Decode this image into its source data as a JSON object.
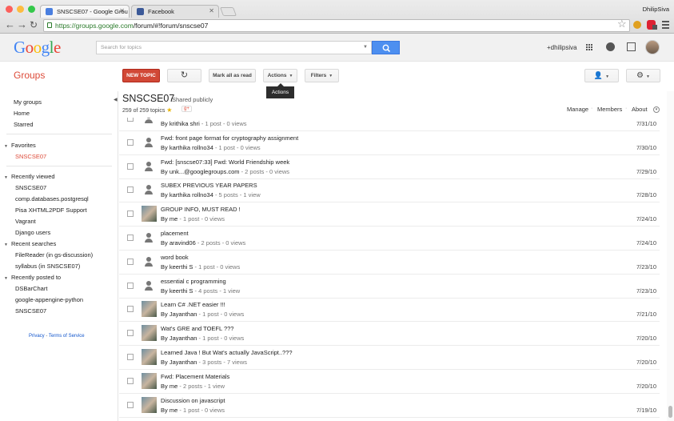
{
  "browser": {
    "tabs": [
      {
        "label": "SNSCSE07 - Google Grou",
        "active": true
      },
      {
        "label": "Facebook",
        "active": false
      }
    ],
    "user": "DhilipSiva",
    "url_host": "https://groups.google.com",
    "url_path": "/forum/#!forum/snscse07"
  },
  "gbar": {
    "logo": "Google",
    "search_placeholder": "Search for topics",
    "plus_user": "+dhilipsiva"
  },
  "toolbar": {
    "app_title": "Groups",
    "new_topic": "NEW TOPIC",
    "mark_read": "Mark all as read",
    "actions": "Actions",
    "filters": "Filters",
    "tooltip": "Actions"
  },
  "sidebar": {
    "top": [
      "My groups",
      "Home",
      "Starred"
    ],
    "favorites_title": "Favorites",
    "favorites": [
      "SNSCSE07"
    ],
    "recently_viewed_title": "Recently viewed",
    "recently_viewed": [
      "SNSCSE07",
      "comp.databases.postgresql",
      "Pisa XHTML2PDF Support",
      "Vagrant",
      "Django users"
    ],
    "recent_searches_title": "Recent searches",
    "recent_searches": [
      "FileReader (in gs-discussion)",
      "syllabus (in SNSCSE07)"
    ],
    "recently_posted_title": "Recently posted to",
    "recently_posted": [
      "DSBarChart",
      "google-appengine-python",
      "SNSCSE07"
    ],
    "privacy": "Privacy",
    "terms": "Terms of Service"
  },
  "group": {
    "name": "SNSCSE07",
    "shared": "Shared publicly",
    "topic_count": "259 of 259 topics",
    "gplus": "g+",
    "manage": "Manage",
    "members": "Members",
    "about": "About"
  },
  "topics": [
    {
      "subject": "",
      "by": "By krithika shri",
      "stats": "1 post - 0 views",
      "date": "7/31/10",
      "pic": "person"
    },
    {
      "subject": "Fwd: front page format for cryptography assignment",
      "by": "By karthika rollno34",
      "stats": "1 post - 0 views",
      "date": "7/30/10",
      "pic": "person"
    },
    {
      "subject": "Fwd: [snscse07:33] Fwd: World Friendship week",
      "by": "By unk...@googlegroups.com",
      "stats": "2 posts - 0 views",
      "date": "7/29/10",
      "pic": "person"
    },
    {
      "subject": "SUBEX PREVIOUS YEAR PAPERS",
      "by": "By karthika rollno34",
      "stats": "5 posts - 1 view",
      "date": "7/28/10",
      "pic": "person"
    },
    {
      "subject": "GROUP INFO, MUST READ !",
      "by": "By me",
      "stats": "1 post - 0 views",
      "date": "7/24/10",
      "pic": "photo"
    },
    {
      "subject": "placement",
      "by": "By aravind06",
      "stats": "2 posts - 0 views",
      "date": "7/24/10",
      "pic": "person"
    },
    {
      "subject": "word book",
      "by": "By keerthi S",
      "stats": "1 post - 0 views",
      "date": "7/23/10",
      "pic": "person"
    },
    {
      "subject": "essential c programming",
      "by": "By keerthi S",
      "stats": "4 posts - 1 view",
      "date": "7/23/10",
      "pic": "person"
    },
    {
      "subject": "Learn C# .NET easier !!!",
      "by": "By Jayanthan",
      "stats": "1 post - 0 views",
      "date": "7/21/10",
      "pic": "photo"
    },
    {
      "subject": "Wat's GRE and TOEFL ???",
      "by": "By Jayanthan",
      "stats": "1 post - 0 views",
      "date": "7/20/10",
      "pic": "photo"
    },
    {
      "subject": "Learned Java ! But Wat's actually JavaScript..???",
      "by": "By Jayanthan",
      "stats": "3 posts - 7 views",
      "date": "7/20/10",
      "pic": "photo"
    },
    {
      "subject": "Fwd: Placement Materials",
      "by": "By me",
      "stats": "2 posts - 1 view",
      "date": "7/20/10",
      "pic": "photo"
    },
    {
      "subject": "Discussion on javascript",
      "by": "By me",
      "stats": "1 post - 0 views",
      "date": "7/19/10",
      "pic": "photo"
    }
  ]
}
